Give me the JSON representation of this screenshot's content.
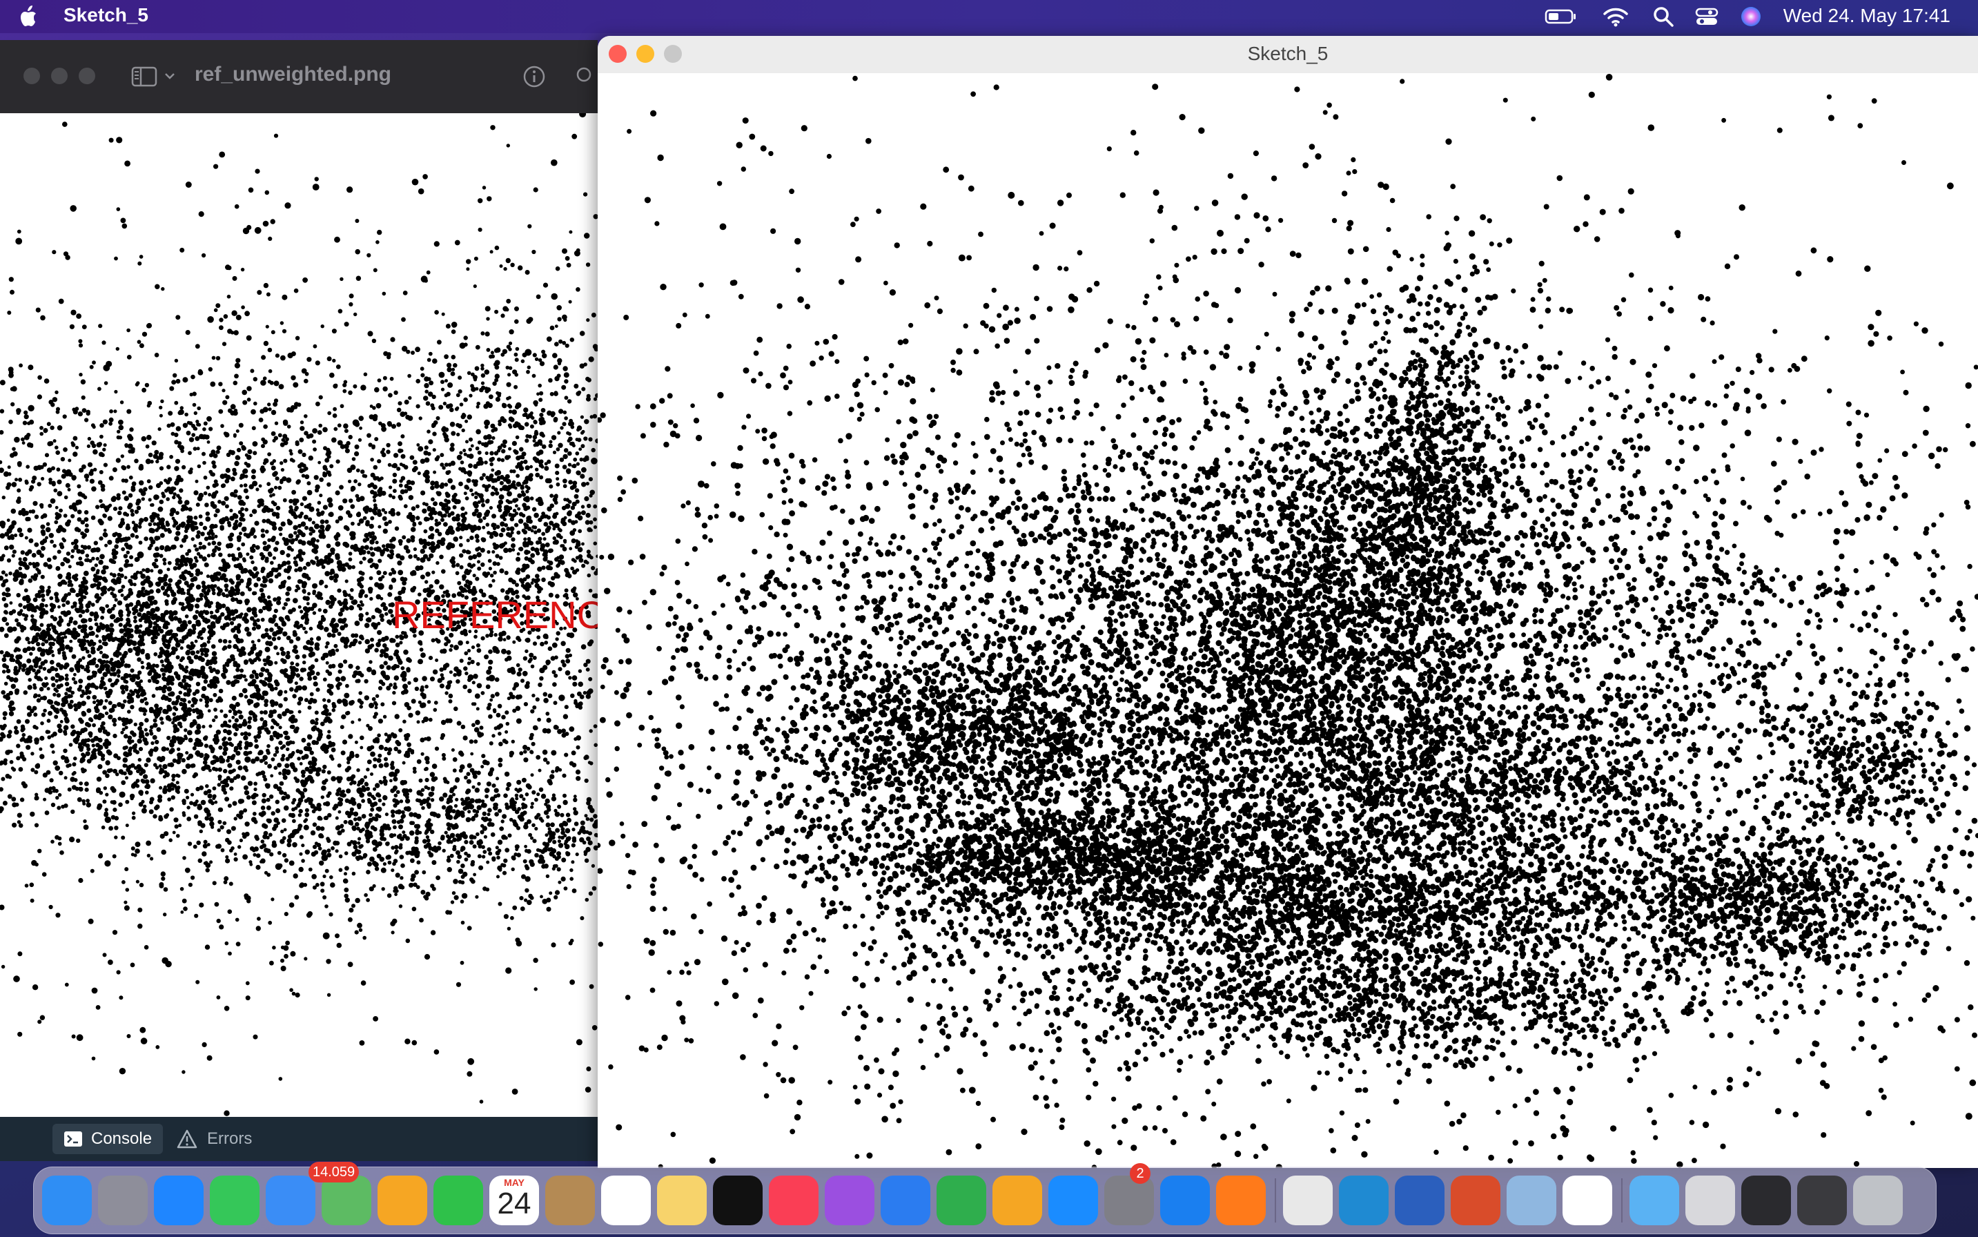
{
  "menubar": {
    "app_name": "Sketch_5",
    "clock": "Wed 24. May  17:41"
  },
  "preview": {
    "filename": "ref_unweighted.png",
    "overlay_label": "REFERENCE"
  },
  "console": {
    "console_label": "Console",
    "errors_label": "Errors"
  },
  "sketch": {
    "title": "Sketch_5"
  },
  "dock": {
    "apps": [
      {
        "name": "Finder",
        "color": "#2f8ef4"
      },
      {
        "name": "Launchpad",
        "color": "#8e8e9a"
      },
      {
        "name": "Safari",
        "color": "#1f86ff"
      },
      {
        "name": "Messages",
        "color": "#35c759"
      },
      {
        "name": "Mail",
        "color": "#3a8df6"
      },
      {
        "name": "Maps",
        "color": "#5dbb63"
      },
      {
        "name": "Photos",
        "color": "#f6a623"
      },
      {
        "name": "FaceTime",
        "color": "#2fc14a"
      },
      {
        "name": "Calendar",
        "color": "#ffffff"
      },
      {
        "name": "Contacts",
        "color": "#b48a54"
      },
      {
        "name": "Reminders",
        "color": "#ffffff"
      },
      {
        "name": "Notes",
        "color": "#f7d36b"
      },
      {
        "name": "TV",
        "color": "#111111"
      },
      {
        "name": "Music",
        "color": "#fa3e55"
      },
      {
        "name": "Podcasts",
        "color": "#9b4fe0"
      },
      {
        "name": "Keynote",
        "color": "#2b7cf0"
      },
      {
        "name": "Numbers",
        "color": "#2fae4d"
      },
      {
        "name": "Pages",
        "color": "#f5a623"
      },
      {
        "name": "App Store",
        "color": "#1a8cff"
      },
      {
        "name": "System Settings",
        "color": "#7f7f87"
      },
      {
        "name": "Xcode",
        "color": "#1a7ff0"
      },
      {
        "name": "Firefox",
        "color": "#ff7a1a"
      },
      {
        "name": "Chrome",
        "color": "#e8e8e8"
      },
      {
        "name": "VS Code",
        "color": "#1f8ad2"
      },
      {
        "name": "Word",
        "color": "#2b5fbd"
      },
      {
        "name": "Instruments",
        "color": "#d94c2a"
      },
      {
        "name": "Preview",
        "color": "#8fb7e0"
      },
      {
        "name": "Processing",
        "color": "#ffffff"
      },
      {
        "name": "Folder",
        "color": "#5ab2f3"
      },
      {
        "name": "Window 1",
        "color": "#d8d8dc"
      },
      {
        "name": "Window 2",
        "color": "#2a2a2e"
      },
      {
        "name": "Window 3",
        "color": "#3a3a3e"
      },
      {
        "name": "Trash",
        "color": "#bfc2c7"
      }
    ],
    "mail_badge": "14.059",
    "settings_badge": "2",
    "calendar_month": "MAY",
    "calendar_day": "24"
  },
  "colors": {
    "reference_red": "#e01515",
    "close": "#ff5f57",
    "minimize": "#febc2e",
    "zoom": "#c8c8c8"
  }
}
